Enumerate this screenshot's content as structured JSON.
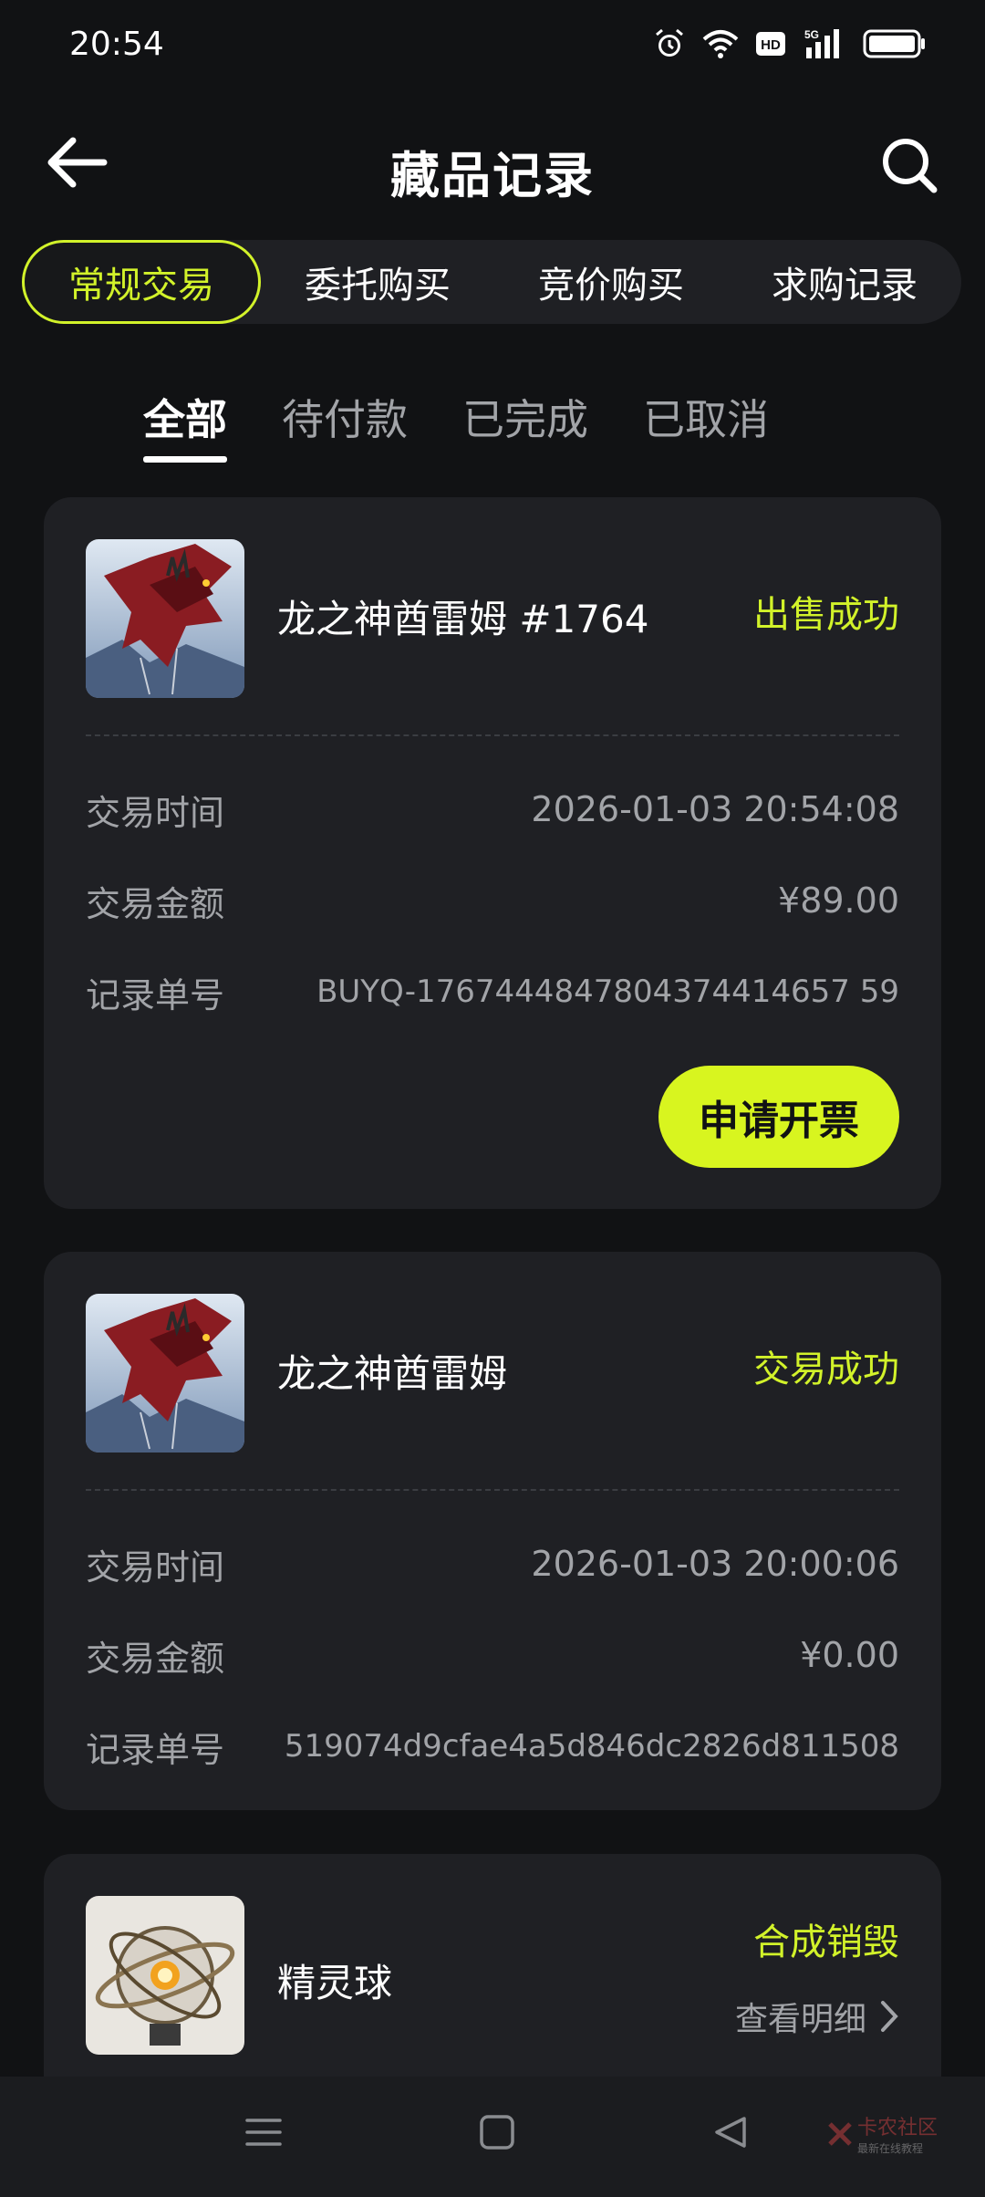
{
  "status_bar": {
    "time": "20:54",
    "icons": [
      "alarm-icon",
      "wifi-icon",
      "hd-icon",
      "signal-5g-icon",
      "battery-icon"
    ]
  },
  "header": {
    "title": "藏品记录",
    "back_icon": "arrow-left-icon",
    "search_icon": "search-icon"
  },
  "top_tabs": [
    {
      "label": "常规交易",
      "active": true
    },
    {
      "label": "委托购买",
      "active": false
    },
    {
      "label": "竞价购买",
      "active": false
    },
    {
      "label": "求购记录",
      "active": false
    }
  ],
  "sub_tabs": [
    {
      "label": "全部",
      "active": true
    },
    {
      "label": "待付款",
      "active": false
    },
    {
      "label": "已完成",
      "active": false
    },
    {
      "label": "已取消",
      "active": false
    }
  ],
  "records": [
    {
      "name": "龙之神酋雷姆 #1764",
      "status": "出售成功",
      "thumb": "dragon-image",
      "rows": [
        {
          "label": "交易时间",
          "value": "2026-01-03 20:54:08"
        },
        {
          "label": "交易金额",
          "value": "¥89.00"
        },
        {
          "label": "记录单号",
          "value": "BUYQ-1767444847804374414657 59"
        }
      ],
      "button": "申请开票"
    },
    {
      "name": "龙之神酋雷姆",
      "status": "交易成功",
      "thumb": "dragon-image",
      "rows": [
        {
          "label": "交易时间",
          "value": "2026-01-03 20:00:06"
        },
        {
          "label": "交易金额",
          "value": "¥0.00"
        },
        {
          "label": "记录单号",
          "value": "519074d9cfae4a5d846dc2826d811508"
        }
      ]
    },
    {
      "name": "精灵球",
      "status": "合成销毁",
      "thumb": "orb-image",
      "detail_link": "查看明细"
    }
  ],
  "nav_bar": {
    "icons": [
      "menu-icon",
      "home-icon",
      "back-triangle-icon"
    ],
    "watermark": "卡农社区",
    "watermark_sub": "最新在线教程"
  },
  "colors": {
    "accent": "#d2f22a",
    "background": "#111214",
    "card": "#1f2024",
    "muted_text": "#a2a4a8"
  }
}
